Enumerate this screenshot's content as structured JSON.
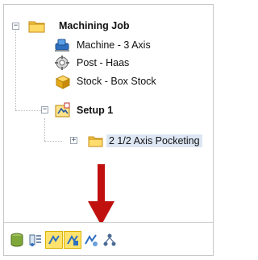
{
  "tree": {
    "root": {
      "label": "Machining Job",
      "icon": "folder-icon",
      "expander": "−"
    },
    "children": [
      {
        "label": "Machine - 3 Axis",
        "icon": "machine-icon"
      },
      {
        "label": "Post - Haas",
        "icon": "post-processor-icon"
      },
      {
        "label": "Stock - Box Stock",
        "icon": "stock-box-icon"
      }
    ],
    "setup": {
      "label": "Setup 1",
      "icon": "setup-icon",
      "expander": "−"
    },
    "operation": {
      "label": "2 1/2 Axis Pocketing",
      "icon": "folder-icon",
      "expander": "+"
    }
  },
  "toolbar": {
    "buttons": [
      {
        "name": "database-icon",
        "active": false
      },
      {
        "name": "tool-list-icon",
        "active": false
      },
      {
        "name": "toolpath-a-icon",
        "active": true
      },
      {
        "name": "toolpath-b-icon",
        "active": true
      },
      {
        "name": "toolpath-c-icon",
        "active": false
      },
      {
        "name": "network-icon",
        "active": false
      }
    ]
  },
  "annotation": {
    "arrow_color": "#c0110f"
  }
}
